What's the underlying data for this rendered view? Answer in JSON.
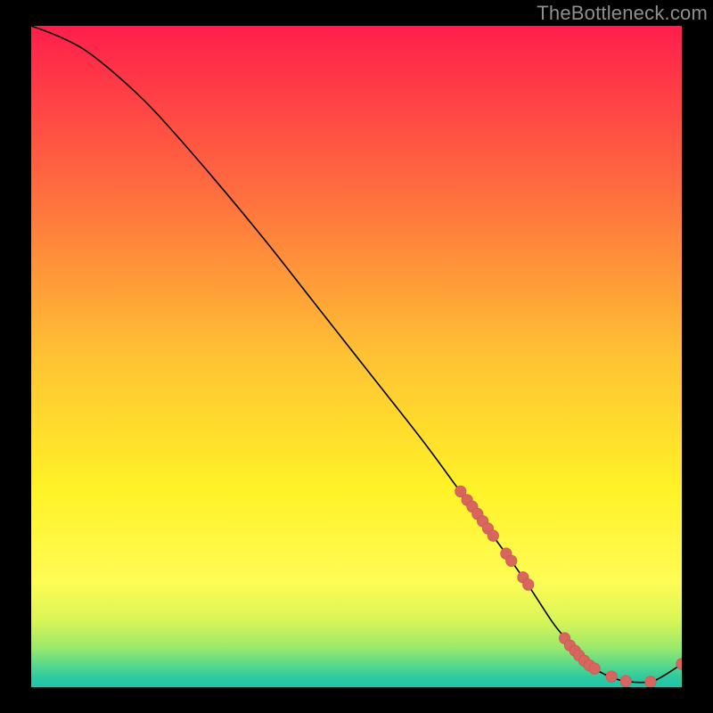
{
  "watermark": "TheBottleneck.com",
  "colors": {
    "background": "#000000",
    "line": "#000000",
    "marker_fill": "#d9655f",
    "marker_stroke": "#c95852"
  },
  "chart_data": {
    "type": "line",
    "title": "",
    "xlabel": "",
    "ylabel": "",
    "xlim": [
      0,
      100
    ],
    "ylim": [
      0,
      100
    ],
    "gradient_stops": [
      {
        "offset": 0.0,
        "color": "#ff1e4b"
      },
      {
        "offset": 0.25,
        "color": "#ff6d3f"
      },
      {
        "offset": 0.5,
        "color": "#ffc233"
      },
      {
        "offset": 0.7,
        "color": "#fff227"
      },
      {
        "offset": 0.84,
        "color": "#fffc55"
      },
      {
        "offset": 0.9,
        "color": "#d8f556"
      },
      {
        "offset": 0.94,
        "color": "#9ce96c"
      },
      {
        "offset": 0.965,
        "color": "#5cd988"
      },
      {
        "offset": 0.985,
        "color": "#2ecba0"
      },
      {
        "offset": 1.0,
        "color": "#1fc4ab"
      }
    ],
    "series": [
      {
        "name": "curve",
        "x": [
          0,
          4,
          8,
          12,
          16,
          20,
          28,
          36,
          44,
          52,
          60,
          66,
          72,
          76,
          80,
          82,
          84,
          86,
          88,
          90,
          92,
          95,
          97,
          100
        ],
        "y": [
          100,
          98.5,
          96.5,
          93.5,
          90,
          86,
          77,
          67.5,
          57.5,
          47.5,
          37.5,
          29.5,
          21.5,
          16,
          10,
          7.5,
          5,
          3.2,
          2,
          1.2,
          0.8,
          0.8,
          1.6,
          3.5
        ]
      }
    ],
    "markers": [
      {
        "x": 66.0,
        "y": 29.6
      },
      {
        "x": 67.0,
        "y": 28.3
      },
      {
        "x": 67.8,
        "y": 27.3
      },
      {
        "x": 68.6,
        "y": 26.2
      },
      {
        "x": 69.4,
        "y": 25.1
      },
      {
        "x": 70.2,
        "y": 24.0
      },
      {
        "x": 71.0,
        "y": 22.9
      },
      {
        "x": 73.0,
        "y": 20.2
      },
      {
        "x": 73.8,
        "y": 19.1
      },
      {
        "x": 75.6,
        "y": 16.6
      },
      {
        "x": 76.4,
        "y": 15.5
      },
      {
        "x": 82.0,
        "y": 7.4
      },
      {
        "x": 82.8,
        "y": 6.3
      },
      {
        "x": 83.6,
        "y": 5.5
      },
      {
        "x": 84.2,
        "y": 4.8
      },
      {
        "x": 85.0,
        "y": 4.0
      },
      {
        "x": 85.8,
        "y": 3.3
      },
      {
        "x": 86.6,
        "y": 2.8
      },
      {
        "x": 89.2,
        "y": 1.6
      },
      {
        "x": 91.4,
        "y": 0.9
      },
      {
        "x": 95.2,
        "y": 0.8
      },
      {
        "x": 100.0,
        "y": 3.5
      }
    ]
  }
}
